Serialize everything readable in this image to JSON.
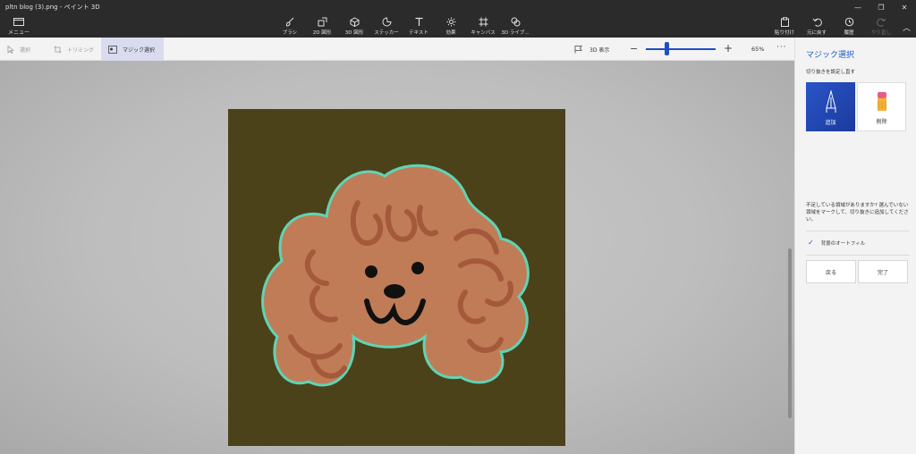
{
  "window": {
    "title": "pltn blog (3).png - ペイント 3D",
    "minimize": "—",
    "maximize": "❐",
    "close": "✕"
  },
  "menu": {
    "label": "メニュー"
  },
  "ribbon": {
    "tools": [
      {
        "label": "ブラシ",
        "icon": "brush-icon"
      },
      {
        "label": "2D 図形",
        "icon": "shape-2d-icon"
      },
      {
        "label": "3D 図形",
        "icon": "cube-icon"
      },
      {
        "label": "ステッカー",
        "icon": "sticker-icon"
      },
      {
        "label": "テキスト",
        "icon": "text-icon"
      },
      {
        "label": "効果",
        "icon": "sun-icon"
      },
      {
        "label": "キャンバス",
        "icon": "canvas-icon"
      },
      {
        "label": "3D ライブ...",
        "icon": "library-icon"
      }
    ],
    "right": [
      {
        "label": "貼り付け",
        "icon": "paste-icon"
      },
      {
        "label": "元に戻す",
        "icon": "undo-icon"
      },
      {
        "label": "履歴",
        "icon": "history-icon"
      },
      {
        "label": "やり直し",
        "icon": "redo-icon"
      }
    ]
  },
  "subtoolbar": {
    "select": "選択",
    "crop": "トリミング",
    "magic_select": "マジック選択",
    "view3d": "3D 表示",
    "zoom_level": "65%",
    "zoom_fraction": 0.3
  },
  "panel": {
    "title": "マジック選択",
    "subtitle": "切り抜きを設定し直す",
    "add_label": "追加",
    "remove_label": "削除",
    "hint": "不足している領域がありますか? 選んでいない領域をマークして、切り抜きに追加してください。",
    "autofill_label": "背景のオートフィル",
    "back_label": "戻る",
    "done_label": "完了"
  },
  "colors": {
    "accent": "#1d5bc7",
    "canvas_bg": "#4b421a",
    "fur": "#c07c57",
    "curl": "#a5593b",
    "selection_outline": "#5fd4b4"
  }
}
